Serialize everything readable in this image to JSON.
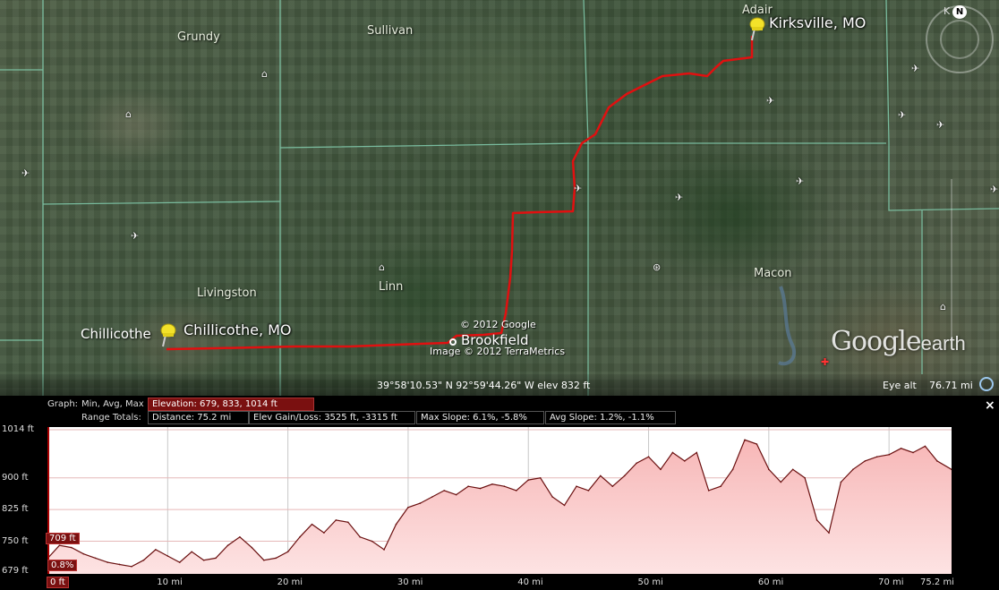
{
  "map": {
    "counties": [
      "Grundy",
      "Sullivan",
      "Adair",
      "Livingston",
      "Linn",
      "Macon"
    ],
    "start_label": "Chillicothe, MO",
    "start_town": "Chillicothe",
    "end_label": "Kirksville, MO",
    "mid_town": "Brookfield",
    "copyright_1": "© 2012 Google",
    "copyright_2": "Image © 2012 TerraMetrics",
    "logo_word": "Google",
    "logo_suffix": "earth",
    "compass_n": "N",
    "compass_k": "K",
    "icons": [
      "airport-icon",
      "school-icon",
      "museum-icon",
      "stadium-icon",
      "hospital-icon"
    ]
  },
  "status": {
    "coords": "39°58'10.53\" N  92°59'44.26\" W  elev   832 ft",
    "eye_label": "Eye alt",
    "eye_value": "76.71 mi"
  },
  "panel": {
    "close": "×",
    "graph_label": "Graph:",
    "graph_mode": "Min, Avg, Max",
    "elevation_stat": "Elevation: 679, 833, 1014 ft",
    "range_totals_label": "Range Totals:",
    "distance": "Distance: 75.2 mi",
    "elev_gain_loss": "Elev Gain/Loss: 3525 ft, -3315 ft",
    "max_slope": "Max Slope: 6.1%, -5.8%",
    "avg_slope": "Avg Slope: 1.2%, -1.1%",
    "cursor_elev": "709 ft",
    "cursor_slope": "0.8%",
    "cursor_dist": "0 ft",
    "end_dist": "75.2 mi"
  },
  "chart_data": {
    "type": "area",
    "xlabel": "",
    "ylabel": "",
    "y_ticks": [
      "1014 ft",
      "900 ft",
      "825 ft",
      "750 ft",
      "679 ft"
    ],
    "y_tick_values": [
      1014,
      900,
      825,
      750,
      679
    ],
    "x_ticks": [
      "10 mi",
      "20 mi",
      "30 mi",
      "40 mi",
      "50 mi",
      "60 mi",
      "70 mi"
    ],
    "x_tick_values": [
      10,
      20,
      30,
      40,
      50,
      60,
      70
    ],
    "xlim": [
      0,
      75.2
    ],
    "ylim": [
      679,
      1014
    ],
    "grid": true,
    "series": [
      {
        "x": [
          0,
          1,
          2,
          3,
          4,
          5,
          6,
          7,
          8,
          9,
          10,
          11,
          12,
          13,
          14,
          15,
          16,
          17,
          18,
          19,
          20,
          21,
          22,
          23,
          24,
          25,
          26,
          27,
          28,
          29,
          30,
          31,
          32,
          33,
          34,
          35,
          36,
          37,
          38,
          39,
          40,
          41,
          42,
          43,
          44,
          45,
          46,
          47,
          48,
          49,
          50,
          51,
          52,
          53,
          54,
          55,
          56,
          57,
          58,
          59,
          60,
          61,
          62,
          63,
          64,
          65,
          66,
          67,
          68,
          69,
          70,
          71,
          72,
          73,
          74,
          75.2
        ],
        "y": [
          709,
          740,
          735,
          720,
          710,
          700,
          695,
          690,
          705,
          730,
          715,
          700,
          725,
          705,
          710,
          740,
          760,
          735,
          705,
          710,
          725,
          760,
          790,
          770,
          800,
          795,
          760,
          750,
          730,
          790,
          830,
          840,
          855,
          870,
          860,
          880,
          875,
          885,
          880,
          870,
          895,
          900,
          855,
          835,
          880,
          870,
          905,
          880,
          905,
          935,
          950,
          920,
          960,
          940,
          960,
          870,
          880,
          920,
          990,
          980,
          920,
          890,
          920,
          900,
          800,
          770,
          890,
          920,
          940,
          950,
          955,
          970,
          960,
          975,
          940,
          920
        ]
      }
    ]
  }
}
